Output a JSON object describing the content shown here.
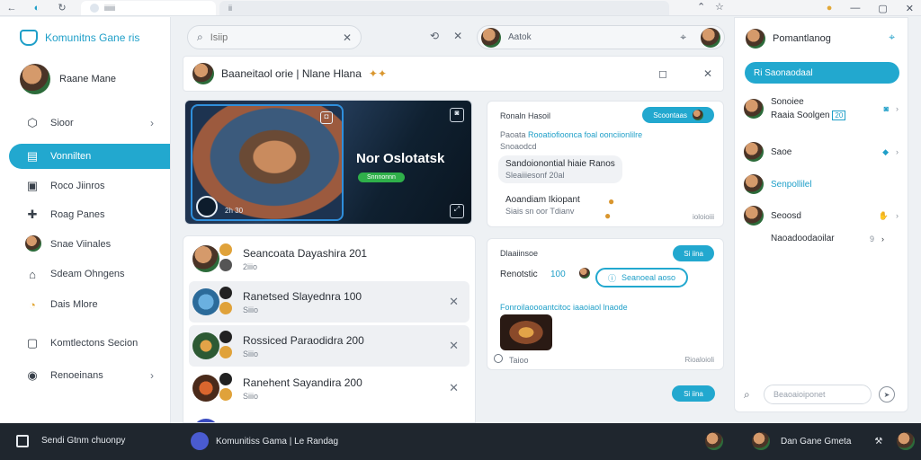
{
  "browser": {
    "tab_active": "iiiiii",
    "tab_inactive": "ii"
  },
  "sidebar": {
    "brand": "Komunitns Gane ris",
    "user": "Raane Mane",
    "items": [
      {
        "label": "Sioor",
        "icon": "cube-icon",
        "chevron": true
      },
      {
        "label": "Vonnilten",
        "icon": "chat-icon",
        "active": true
      },
      {
        "label": "Roco Jiinros",
        "icon": "folder-icon"
      },
      {
        "label": "Roag Panes",
        "icon": "puzzle-icon"
      },
      {
        "label": "Snae Viinales",
        "icon": "avatar"
      },
      {
        "label": "Sdeam Ohngens",
        "icon": "store-icon"
      },
      {
        "label": "Dais Mlore",
        "icon": "pie-icon"
      },
      {
        "label": "Komtlectons Secion",
        "icon": "grid-icon"
      },
      {
        "label": "Renoeinans",
        "icon": "compass-icon",
        "chevron": true
      }
    ]
  },
  "search": {
    "placeholder": "Isiip"
  },
  "header": {
    "title": "Baaneitaol orie | Nlane Hlana"
  },
  "banner": {
    "title": "Nor Oslotatsk",
    "pill": "Snnnonnn",
    "hero_label": "2h 30"
  },
  "list": [
    {
      "title": "Seancoata Dayashira 201",
      "sub": "2iiio"
    },
    {
      "title": "Ranetsed Slayednra 100",
      "sub": "Siiio"
    },
    {
      "title": "Rossiced Paraodidra 200",
      "sub": "Siiio"
    },
    {
      "title": "Ranehent Sayandira 200",
      "sub": "Siiio"
    }
  ],
  "chat": {
    "search_label": "Aatok",
    "msg1": {
      "from": "Ronaln Hasoil",
      "action": "Scoontaas",
      "link_prefix": "Paoata",
      "link": "Rooatiofioonca foal oonciionlilre",
      "gray": "Snoaodcd",
      "bubble1": "Sandoionontial hiaie Ranos",
      "bubble1b": "Sleaiiiesonf 20al",
      "bubble2": "Aoandiam Ikiopant",
      "bubble2b": "Siais sn oor Tdianv",
      "time": "ioloioiii"
    },
    "msg2": {
      "from": "Dlaaiinsoe",
      "action": "Si iina",
      "label": "Renotstic",
      "count": "100",
      "chip": "Seanoeal aoso",
      "link": "Fonroilaoooantcitoc iaaoiaol lnaode",
      "footer": "Taioo",
      "time": "Rioaloioli"
    },
    "float_button": "Si iina"
  },
  "right_panel": {
    "user": "Pomantlanog",
    "active_item": "Ri Saonaodaal",
    "items": [
      {
        "title": "Sonoiee",
        "sub": "Raaia Soolgen",
        "badge": "20"
      },
      {
        "title": "Saoe"
      },
      {
        "title": "Senpollilel"
      },
      {
        "title": "Seoosd"
      },
      {
        "title": "Naoadoodaoilar",
        "meta": "9"
      }
    ],
    "compose_placeholder": "Beaoaioiponet"
  },
  "taskbar": {
    "label": "Sendi Gtnm chuonpy",
    "app": "Komunitiss Gama | Le Randag",
    "tray_user": "Dan Gane Gmeta"
  }
}
